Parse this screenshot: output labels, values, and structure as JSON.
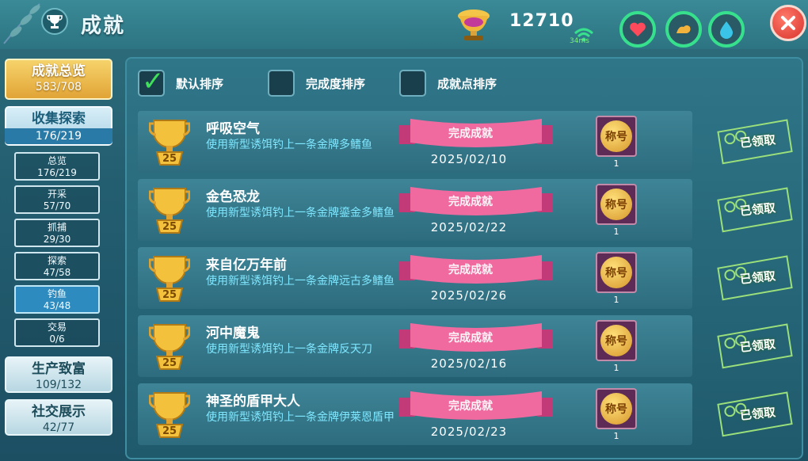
{
  "header": {
    "title": "成就",
    "score": "12710",
    "ping": "34ms"
  },
  "sidebar": {
    "overview": {
      "label": "成就总览",
      "value": "583/708"
    },
    "collect": {
      "label": "收集探索",
      "value": "176/219"
    },
    "subs": [
      {
        "label": "总览",
        "value": "176/219"
      },
      {
        "label": "开采",
        "value": "57/70"
      },
      {
        "label": "抓捕",
        "value": "29/30"
      },
      {
        "label": "探索",
        "value": "47/58"
      },
      {
        "label": "钓鱼",
        "value": "43/48"
      },
      {
        "label": "交易",
        "value": "0/6"
      }
    ],
    "production": {
      "label": "生产致富",
      "value": "109/132"
    },
    "social": {
      "label": "社交展示",
      "value": "42/77"
    }
  },
  "sort": {
    "default": "默认排序",
    "completion": "完成度排序",
    "points": "成就点排序"
  },
  "achievements": [
    {
      "name": "呼吸空气",
      "desc": "使用新型诱饵钓上一条金牌多鳍鱼",
      "level": "25",
      "status": "完成成就",
      "date": "2025/02/10",
      "reward": "称号",
      "qty": "1",
      "claim": "已领取"
    },
    {
      "name": "金色恐龙",
      "desc": "使用新型诱饵钓上一条金牌鎏金多鳍鱼",
      "level": "25",
      "status": "完成成就",
      "date": "2025/02/22",
      "reward": "称号",
      "qty": "1",
      "claim": "已领取"
    },
    {
      "name": "来自亿万年前",
      "desc": "使用新型诱饵钓上一条金牌远古多鳍鱼",
      "level": "25",
      "status": "完成成就",
      "date": "2025/02/26",
      "reward": "称号",
      "qty": "1",
      "claim": "已领取"
    },
    {
      "name": "河中魔鬼",
      "desc": "使用新型诱饵钓上一条金牌反天刀",
      "level": "25",
      "status": "完成成就",
      "date": "2025/02/16",
      "reward": "称号",
      "qty": "1",
      "claim": "已领取"
    },
    {
      "name": "神圣的盾甲大人",
      "desc": "使用新型诱饵钓上一条金牌伊莱恩盾甲",
      "level": "25",
      "status": "完成成就",
      "date": "2025/02/23",
      "reward": "称号",
      "qty": "1",
      "claim": "已领取"
    }
  ]
}
